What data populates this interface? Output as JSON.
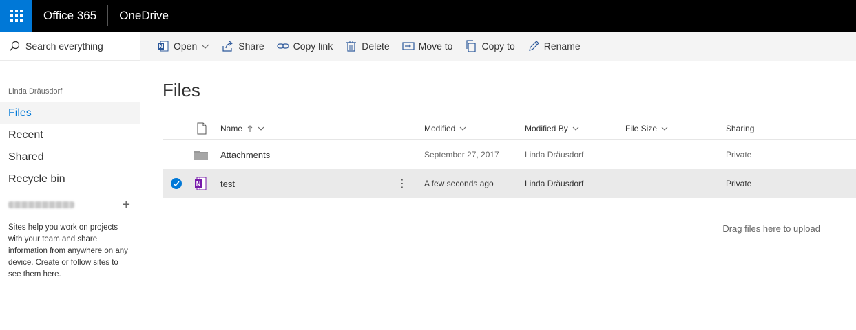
{
  "suitebar": {
    "brand": "Office 365",
    "app": "OneDrive"
  },
  "leftnav": {
    "search_placeholder": "Search everything",
    "user": "Linda Dräusdorf",
    "items": [
      {
        "label": "Files",
        "active": true
      },
      {
        "label": "Recent"
      },
      {
        "label": "Shared"
      },
      {
        "label": "Recycle bin"
      }
    ],
    "sites_text": "Sites help you work on projects with your team and share information from anywhere on any device. Create or follow sites to see them here.",
    "plus": "+"
  },
  "toolbar": {
    "open": "Open",
    "share": "Share",
    "copy_link": "Copy link",
    "delete": "Delete",
    "move_to": "Move to",
    "copy_to": "Copy to",
    "rename": "Rename"
  },
  "main": {
    "title": "Files",
    "columns": {
      "name": "Name",
      "modified": "Modified",
      "modified_by": "Modified By",
      "file_size": "File Size",
      "sharing": "Sharing"
    },
    "rows": [
      {
        "name": "Attachments",
        "type": "folder",
        "modified": "September 27, 2017",
        "modified_by": "Linda Dräusdorf",
        "file_size": "",
        "sharing": "Private",
        "selected": false
      },
      {
        "name": "test",
        "type": "onenote",
        "modified": "A few seconds ago",
        "modified_by": "Linda Dräusdorf",
        "file_size": "",
        "sharing": "Private",
        "selected": true
      }
    ],
    "drag_hint": "Drag files here to upload",
    "more_glyph": "⋮"
  },
  "colors": {
    "accent": "#0078d7",
    "onenote": "#7719aa",
    "suitebar": "#000000",
    "commandbar": "#f4f4f4"
  }
}
